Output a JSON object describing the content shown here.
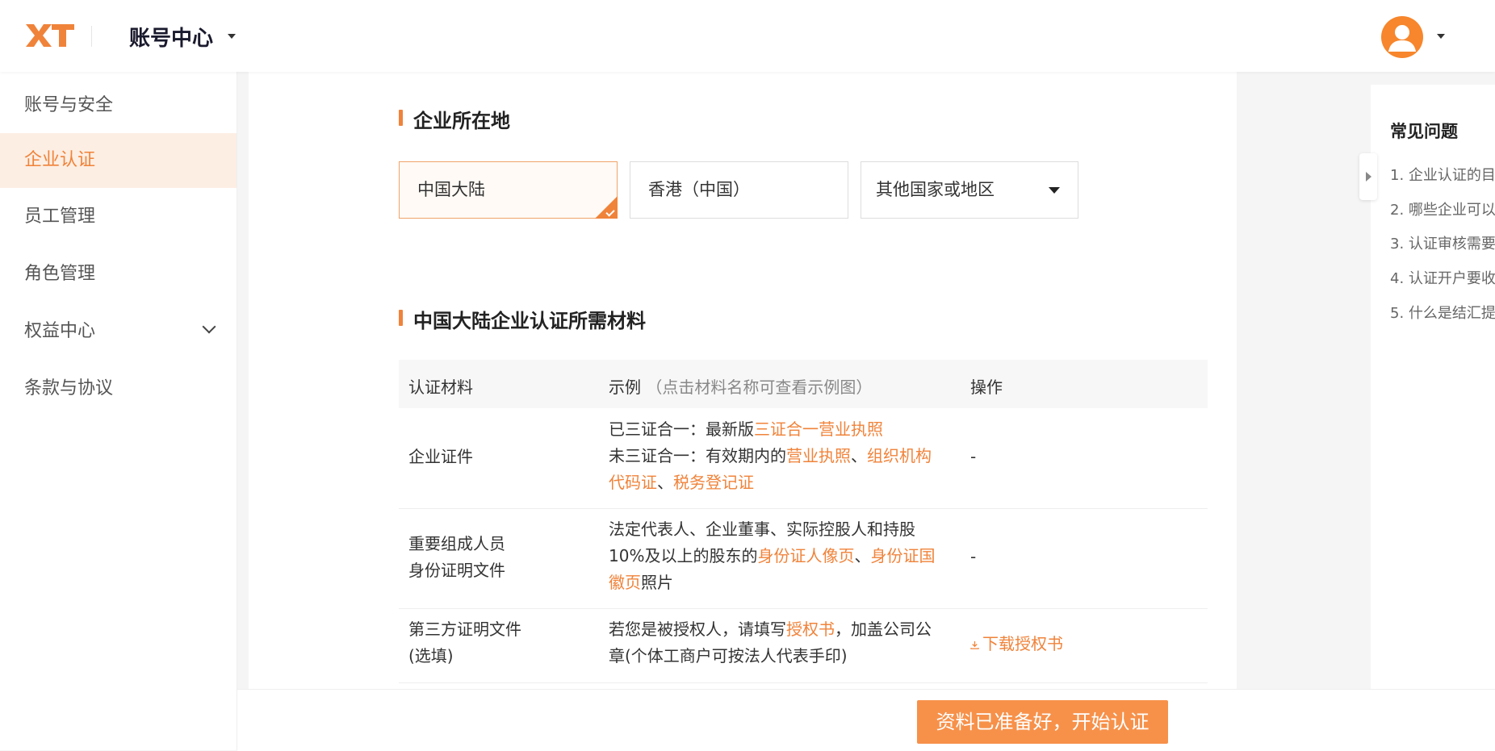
{
  "header": {
    "logo_text": "XT",
    "title": "账号中心",
    "brand_color": "#f0833a"
  },
  "sidebar": {
    "items": [
      {
        "label": "账号与安全"
      },
      {
        "label": "企业认证",
        "active": true
      },
      {
        "label": "员工管理"
      },
      {
        "label": "角色管理"
      },
      {
        "label": "权益中心",
        "expandable": true
      },
      {
        "label": "条款与协议"
      }
    ]
  },
  "location": {
    "title": "企业所在地",
    "options": [
      "中国大陆",
      "香港（中国）",
      "其他国家或地区"
    ],
    "selected": "中国大陆"
  },
  "materials": {
    "title": "中国大陆企业认证所需材料",
    "headers": {
      "col1": "认证材料",
      "col2": "示例",
      "col2_hint": "（点击材料名称可查看示例图）",
      "col3": "操作"
    },
    "rows": [
      {
        "name": "企业证件",
        "ex_line1_prefix": "已三证合一：最新版",
        "ex_line1_link": "三证合一营业执照",
        "ex_line2_prefix": "未三证合一：有效期内的",
        "ex_link_a": "营业执照",
        "ex_sep1": "、",
        "ex_link_b1": "组织机构",
        "ex_link_b2": "代码证",
        "ex_sep2": "、",
        "ex_link_c": "税务登记证",
        "action": "-"
      },
      {
        "name_line1": "重要组成人员",
        "name_line2": "身份证明文件",
        "ex_line1": "法定代表人、企业董事、实际控股人和持股",
        "ex_line2_prefix": "10%及以上的股东的",
        "ex_link_a": "身份证人像页",
        "ex_sep": "、",
        "ex_link_b1": "身份证国",
        "ex_link_b2": "徽页",
        "ex_suffix": "照片",
        "action": "-"
      },
      {
        "name_line1": "第三方证明文件",
        "name_line2": "(选填)",
        "ex_line1_prefix": "若您是被授权人，请填写",
        "ex_line1_link": "授权书",
        "ex_line1_suffix": "，加盖公司公",
        "ex_line2": "章(个体工商户可按法人代表手印)",
        "action": "下载授权书",
        "action_icon": "download-icon"
      }
    ]
  },
  "footer": {
    "start_button": "资料已准备好，开始认证"
  },
  "faq": {
    "title": "常见问题",
    "items": [
      "1. 企业认证的目",
      "2. 哪些企业可以",
      "3. 认证审核需要",
      "4. 认证开户要收",
      "5. 什么是结汇提"
    ]
  }
}
